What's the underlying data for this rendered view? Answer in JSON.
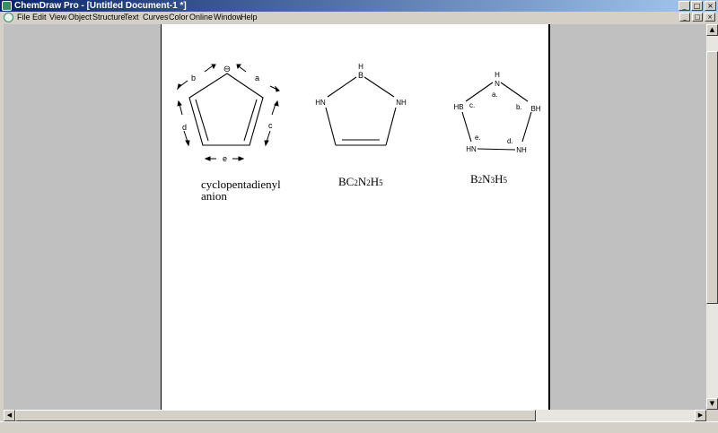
{
  "window": {
    "title": "ChemDraw Pro - [Untitled Document-1 *]",
    "controls": {
      "minimize": "_",
      "maximize": "□",
      "close": "×"
    }
  },
  "menu": {
    "items": [
      "File",
      "Edit",
      "View",
      "Object",
      "Structure",
      "Text",
      "Curves",
      "Color",
      "Online",
      "Window",
      "Help"
    ]
  },
  "document": {
    "molecule1": {
      "charge": "⊖",
      "bond_labels": [
        "a",
        "b",
        "c",
        "d",
        "e"
      ],
      "caption_line1": "cyclopentadienyl",
      "caption_line2": "anion"
    },
    "molecule2": {
      "atoms": {
        "top": "H",
        "boron": "B",
        "left": "HN",
        "right": "NH"
      },
      "formula": [
        "BC",
        "2",
        "N",
        "2",
        "H",
        "5"
      ]
    },
    "molecule3": {
      "atoms": {
        "top_h": "H",
        "top_n": "N",
        "left": "HB",
        "right": "BH",
        "bottom_left": "HN",
        "bottom_right": "NH"
      },
      "bond_labels": [
        "a.",
        "b.",
        "c.",
        "d.",
        "e."
      ],
      "formula": [
        "B",
        "2",
        "N",
        "3",
        "H",
        "5"
      ]
    }
  }
}
